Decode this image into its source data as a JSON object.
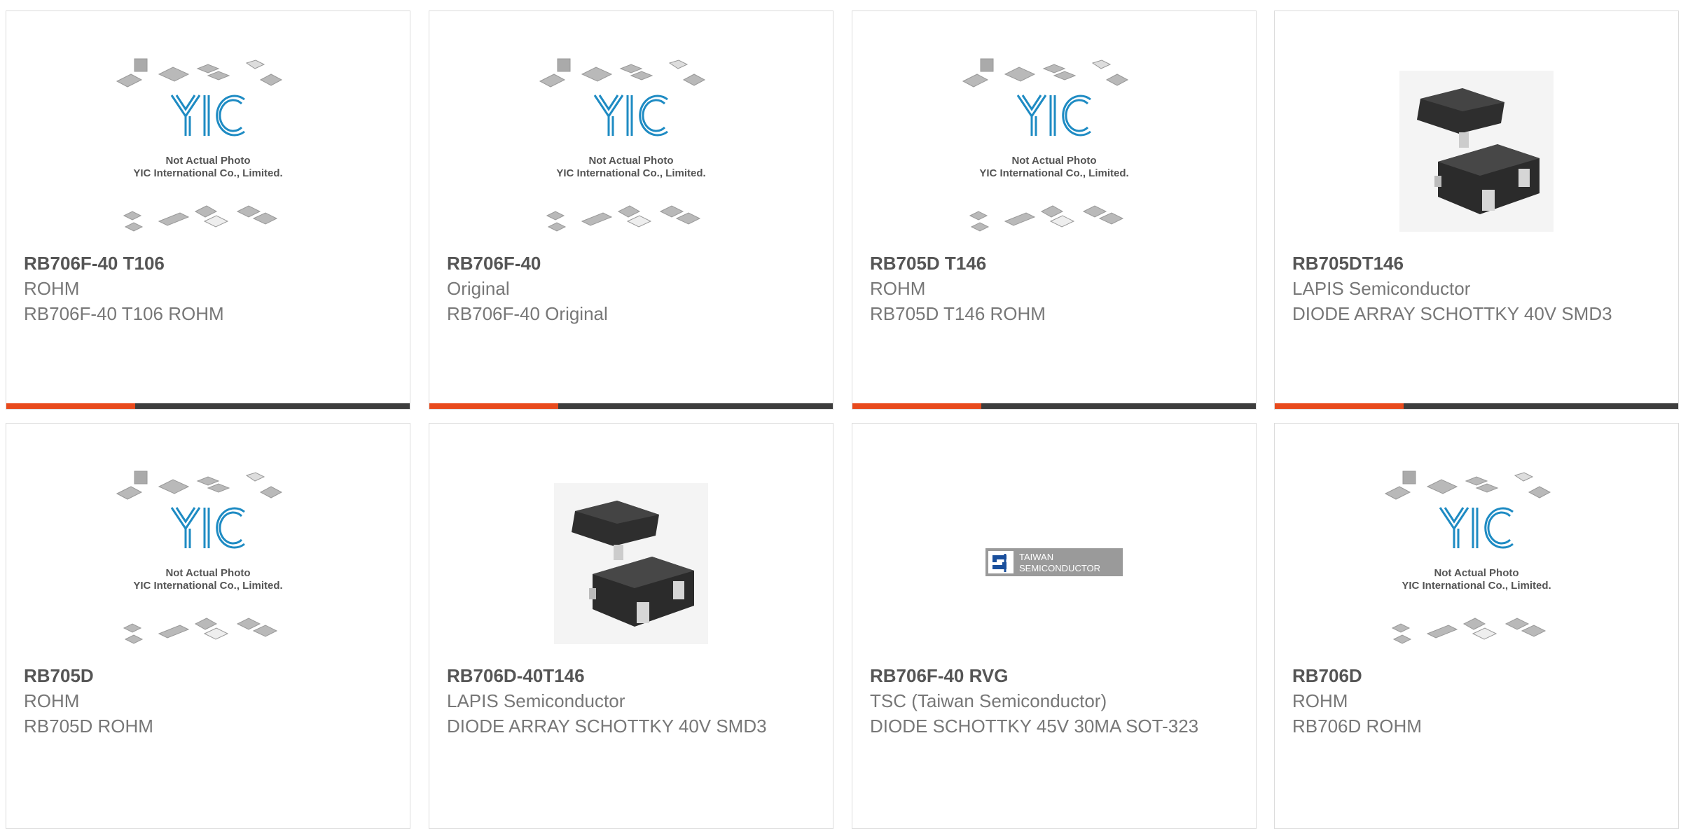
{
  "colors": {
    "accent": "#e84a1d",
    "bar": "#3d3d3d",
    "part_number": "#555555",
    "text": "#777777",
    "yic_blue": "#1e8bc3"
  },
  "placeholder": {
    "logo_text": "YIC",
    "line1": "Not Actual Photo",
    "line2": "YIC International Co., Limited."
  },
  "tsc_logo": {
    "line1": "TAIWAN",
    "line2": "SEMICONDUCTOR"
  },
  "products": [
    {
      "part_number": "RB706F-40 T106",
      "manufacturer": "ROHM",
      "description": "RB706F-40 T106 ROHM",
      "image": "yic-placeholder"
    },
    {
      "part_number": "RB706F-40",
      "manufacturer": "Original",
      "description": "RB706F-40 Original",
      "image": "yic-placeholder"
    },
    {
      "part_number": "RB705D T146",
      "manufacturer": "ROHM",
      "description": "RB705D T146 ROHM",
      "image": "yic-placeholder"
    },
    {
      "part_number": "RB705DT146",
      "manufacturer": "LAPIS Semiconductor",
      "description": "DIODE ARRAY SCHOTTKY 40V SMD3",
      "image": "sot23-component"
    },
    {
      "part_number": "RB705D",
      "manufacturer": "ROHM",
      "description": "RB705D ROHM",
      "image": "yic-placeholder"
    },
    {
      "part_number": "RB706D-40T146",
      "manufacturer": "LAPIS Semiconductor",
      "description": "DIODE ARRAY SCHOTTKY 40V SMD3",
      "image": "sot23-component"
    },
    {
      "part_number": "RB706F-40 RVG",
      "manufacturer": "TSC (Taiwan Semiconductor)",
      "description": "DIODE SCHOTTKY 45V 30MA SOT-323",
      "image": "tsc-logo"
    },
    {
      "part_number": "RB706D",
      "manufacturer": "ROHM",
      "description": "RB706D ROHM",
      "image": "yic-placeholder"
    }
  ]
}
